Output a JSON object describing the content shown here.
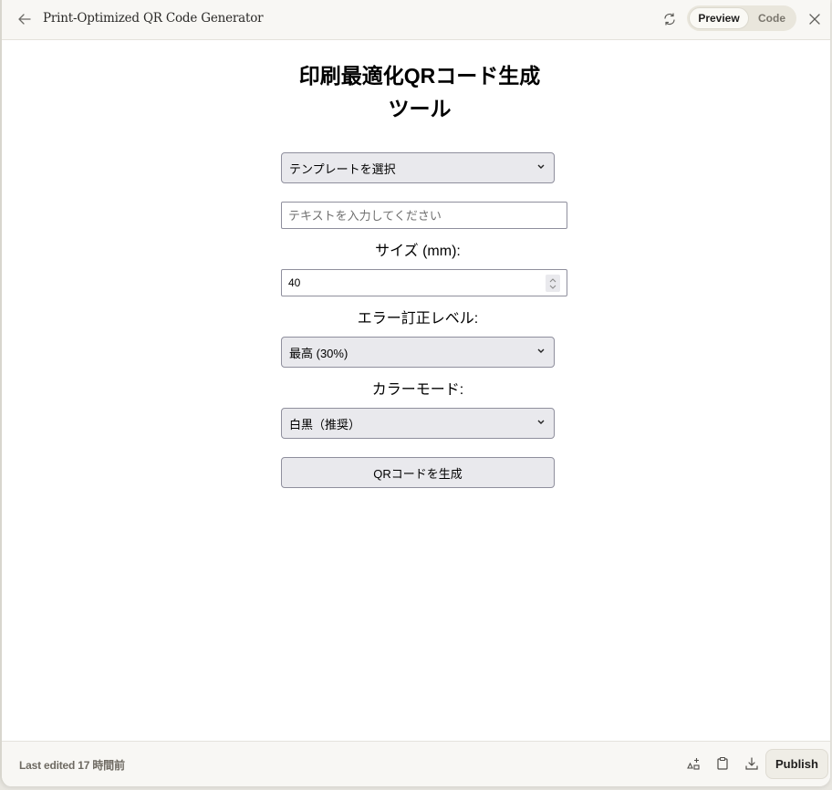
{
  "header": {
    "back_icon": "arrow-left-icon",
    "title": "Print-Optimized QR Code Generator",
    "refresh_icon": "refresh-icon",
    "tabs": [
      {
        "label": "Preview",
        "active": true
      },
      {
        "label": "Code",
        "active": false
      }
    ],
    "close_icon": "close-icon"
  },
  "main": {
    "title_line1": "印刷最適化QRコード生成",
    "title_line2": "ツール",
    "template_select": {
      "value": "テンプレートを選択"
    },
    "text_input": {
      "value": "",
      "placeholder": "テキストを入力してください"
    },
    "size_label": "サイズ (mm):",
    "size_input": {
      "value": "40"
    },
    "error_level_label": "エラー訂正レベル:",
    "error_level_select": {
      "value": "最高 (30%)"
    },
    "color_mode_label": "カラーモード:",
    "color_mode_select": {
      "value": "白黒（推奨）"
    },
    "generate_button": "QRコードを生成"
  },
  "footer": {
    "last_edited": "Last edited 17 時間前",
    "icons": [
      "shapes-icon",
      "clipboard-icon",
      "download-icon"
    ],
    "publish_label": "Publish"
  }
}
